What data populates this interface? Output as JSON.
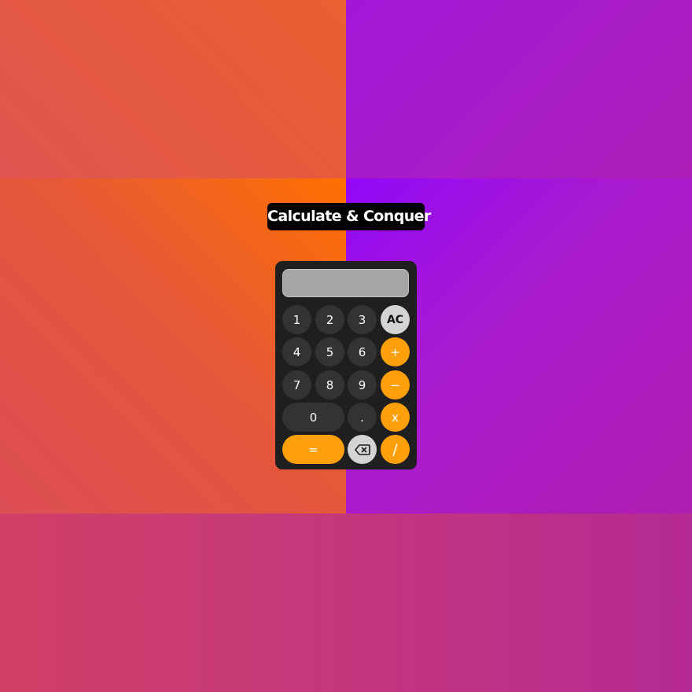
{
  "title": "Calculate & Conquer",
  "display": {
    "value": ""
  },
  "colors": {
    "calculator_body": "#1f1f1f",
    "display": "#a5a5a5",
    "number_key": "#333333",
    "operator_key": "#ff9f0a",
    "function_key": "#d4d4d4"
  },
  "keys": {
    "one": "1",
    "two": "2",
    "three": "3",
    "clear": "AC",
    "four": "4",
    "five": "5",
    "six": "6",
    "plus": "+",
    "seven": "7",
    "eight": "8",
    "nine": "9",
    "minus": "−",
    "zero": "0",
    "decimal": ".",
    "multiply": "x",
    "equals": "=",
    "backspace_icon": "backspace-icon",
    "divide": "/"
  }
}
